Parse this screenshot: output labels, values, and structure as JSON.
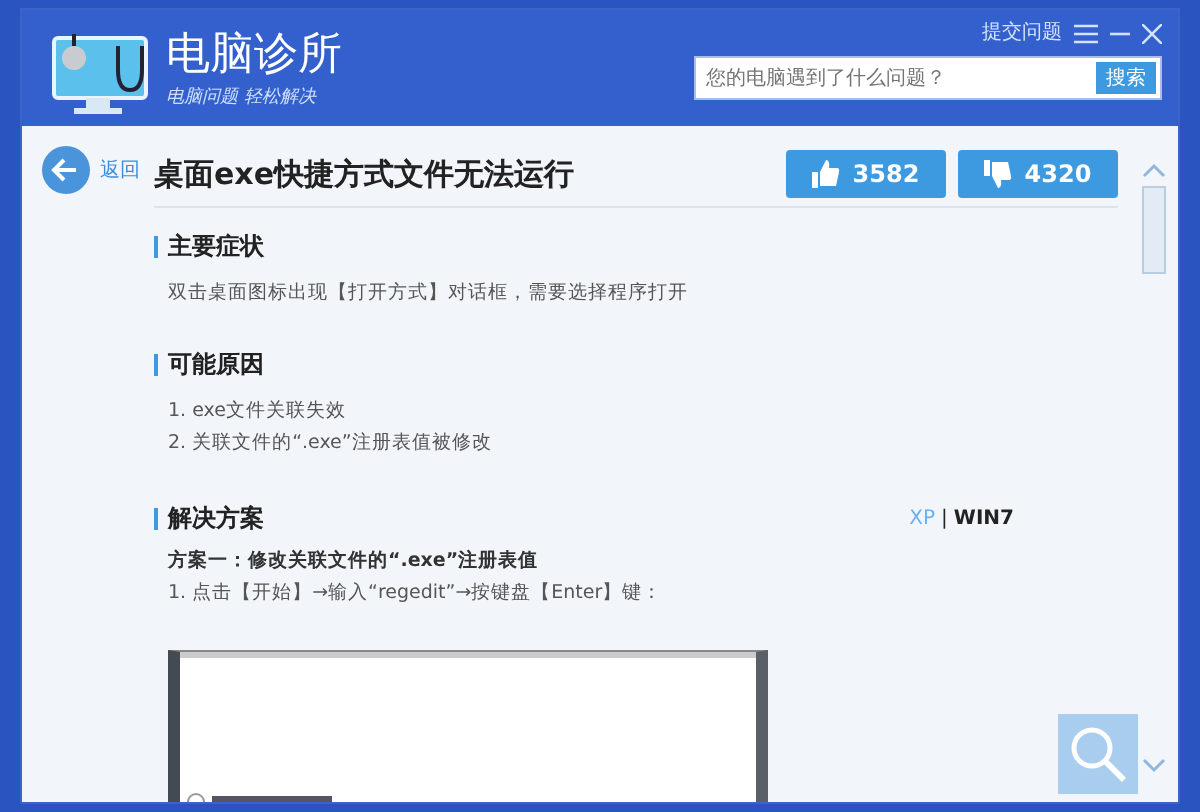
{
  "header": {
    "app_name": "电脑诊所",
    "slogan": "电脑问题 轻松解决",
    "submit_link": "提交问题",
    "search": {
      "placeholder": "您的电脑遇到了什么问题？"
    },
    "search_button": "搜索"
  },
  "article": {
    "back": "返回",
    "title": "桌面exe快捷方式文件无法运行",
    "likes": "3582",
    "dislikes": "4320",
    "sections": [
      {
        "kind": "paragraph",
        "heading": "主要症状",
        "text": "双击桌面图标出现【打开方式】对话框，需要选择程序打开"
      },
      {
        "kind": "list",
        "heading": "可能原因",
        "items": [
          "1. exe文件关联失效",
          "2. 关联文件的“.exe”注册表值被修改"
        ]
      },
      {
        "kind": "solution",
        "heading": "解决方案",
        "os_separator": "|",
        "os_tabs": [
          {
            "label": "XP",
            "selected": false
          },
          {
            "label": "WIN7",
            "selected": true
          }
        ],
        "plan_title": "方案一：修改关联文件的“.exe”注册表值",
        "steps": [
          "1. 点击【开始】→输入“regedit”→按键盘【Enter】键："
        ],
        "screenshot": {
          "kind": "picture"
        }
      }
    ]
  }
}
